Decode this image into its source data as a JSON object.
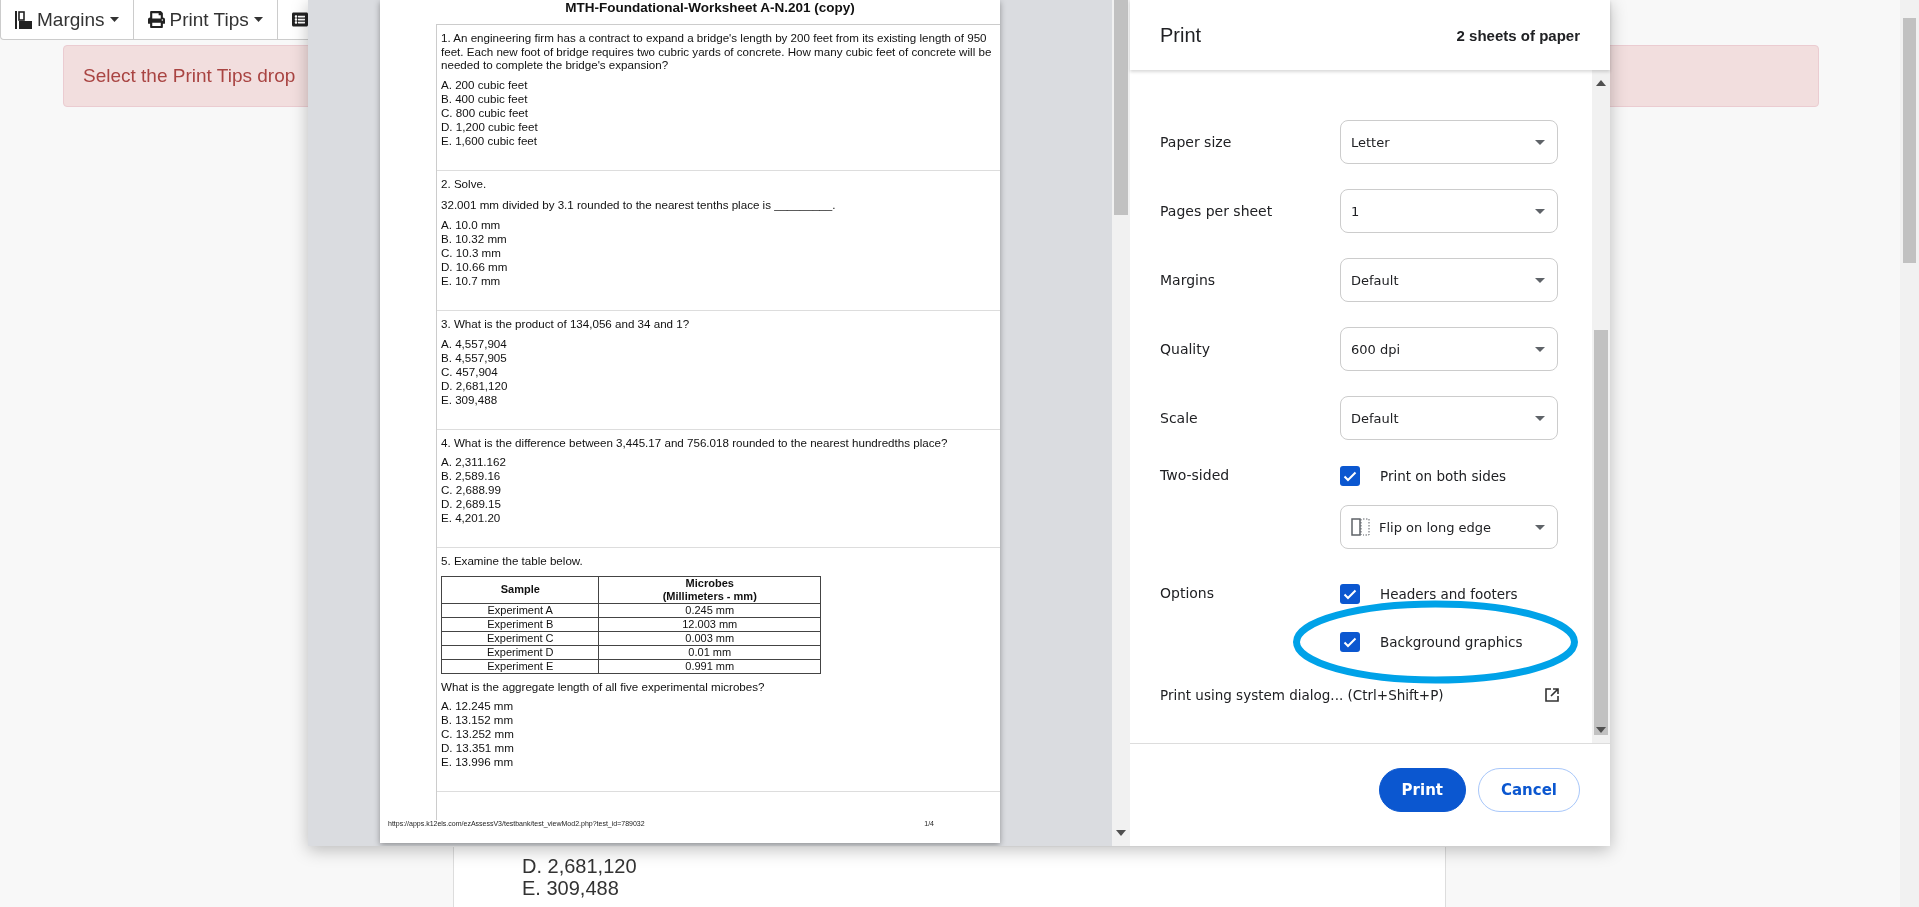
{
  "toolbar": [
    {
      "label": "Margins"
    },
    {
      "label": "Print Tips"
    }
  ],
  "alert": {
    "text": "Select the Print Tips drop"
  },
  "page_behind": {
    "lines": [
      "D. 2,681,120",
      "E. 309,488"
    ]
  },
  "preview": {
    "title": "MTH-Foundational-Worksheet A-N.201 (copy)",
    "questions": [
      {
        "prompt": [
          "1. An engineering firm has a contract to expand a bridge's length by 200 feet from its existing length of 950 feet.  Each new foot of bridge requires two cubric yards of concrete.  How many cubic feet of concrete will be needed to complete the bridge's expansion?"
        ],
        "answers": [
          "A. 200 cubic feet",
          "B. 400 cubic feet",
          "C. 800 cubic feet",
          "D. 1,200 cubic feet",
          "E. 1,600 cubic feet"
        ]
      },
      {
        "prompt": [
          "2. Solve.",
          "32.001 mm divided by 3.1 rounded to the nearest tenths place is _________."
        ],
        "answers": [
          "A. 10.0 mm",
          "B. 10.32 mm",
          "C. 10.3 mm",
          "D. 10.66 mm",
          "E. 10.7 mm"
        ]
      },
      {
        "prompt": [
          "3. What is the product of 134,056 and 34 and 1?"
        ],
        "answers": [
          "A. 4,557,904",
          "B. 4,557,905",
          "C. 457,904",
          "D. 2,681,120",
          "E. 309,488"
        ]
      },
      {
        "prompt": [
          "4. What is the difference between 3,445.17 and 756.018 rounded to the nearest hundredths place?"
        ],
        "answers": [
          "A. 2,311.162",
          "B. 2,589.16",
          "C. 2,688.99",
          "D. 2,689.15",
          "E. 4,201.20"
        ]
      },
      {
        "prompt": [
          "5. Examine the table below."
        ],
        "table": {
          "columns": [
            "Sample",
            "Microbes\n(Millimeters - mm)"
          ],
          "rows": [
            [
              "Experiment A",
              "0.245 mm"
            ],
            [
              "Experiment B",
              "12.003 mm"
            ],
            [
              "Experiment C",
              "0.003 mm"
            ],
            [
              "Experiment D",
              "0.01 mm"
            ],
            [
              "Experiment E",
              "0.991 mm"
            ]
          ]
        },
        "after": "What is the aggregate length of all five experimental microbes?",
        "answers": [
          "A. 12.245 mm",
          "B. 13.152 mm",
          "C. 13.252 mm",
          "D. 13.351 mm",
          "E. 13.996 mm"
        ]
      }
    ],
    "footer_url": "https://apps.k12els.com/ezAssessV3/testbank/test_viewMod2.php?test_id=789032",
    "page_number": "1/4"
  },
  "print_panel": {
    "title": "Print",
    "sheets": "2 sheets of paper",
    "settings": [
      {
        "label": "Paper size",
        "kind": "select",
        "value": "Letter"
      },
      {
        "label": "Pages per sheet",
        "kind": "select",
        "value": "1"
      },
      {
        "label": "Margins",
        "kind": "select",
        "value": "Default"
      },
      {
        "label": "Quality",
        "kind": "select",
        "value": "600 dpi"
      },
      {
        "label": "Scale",
        "kind": "select",
        "value": "Default"
      },
      {
        "label": "Two-sided",
        "kind": "checklist",
        "items": [
          {
            "text": "Print on both sides",
            "checked": true,
            "highlighted": false
          }
        ],
        "select": {
          "value": "Flip on long edge"
        }
      },
      {
        "label": "Options",
        "kind": "checklist",
        "items": [
          {
            "text": "Headers and footers",
            "checked": true,
            "highlighted": false
          },
          {
            "text": "Background graphics",
            "checked": true,
            "highlighted": true
          }
        ]
      }
    ],
    "system_dialog": "Print using system dialog... (Ctrl+Shift+P)",
    "buttons": [
      {
        "label": "Print",
        "kind": "primary"
      },
      {
        "label": "Cancel",
        "kind": "secondary"
      }
    ]
  }
}
